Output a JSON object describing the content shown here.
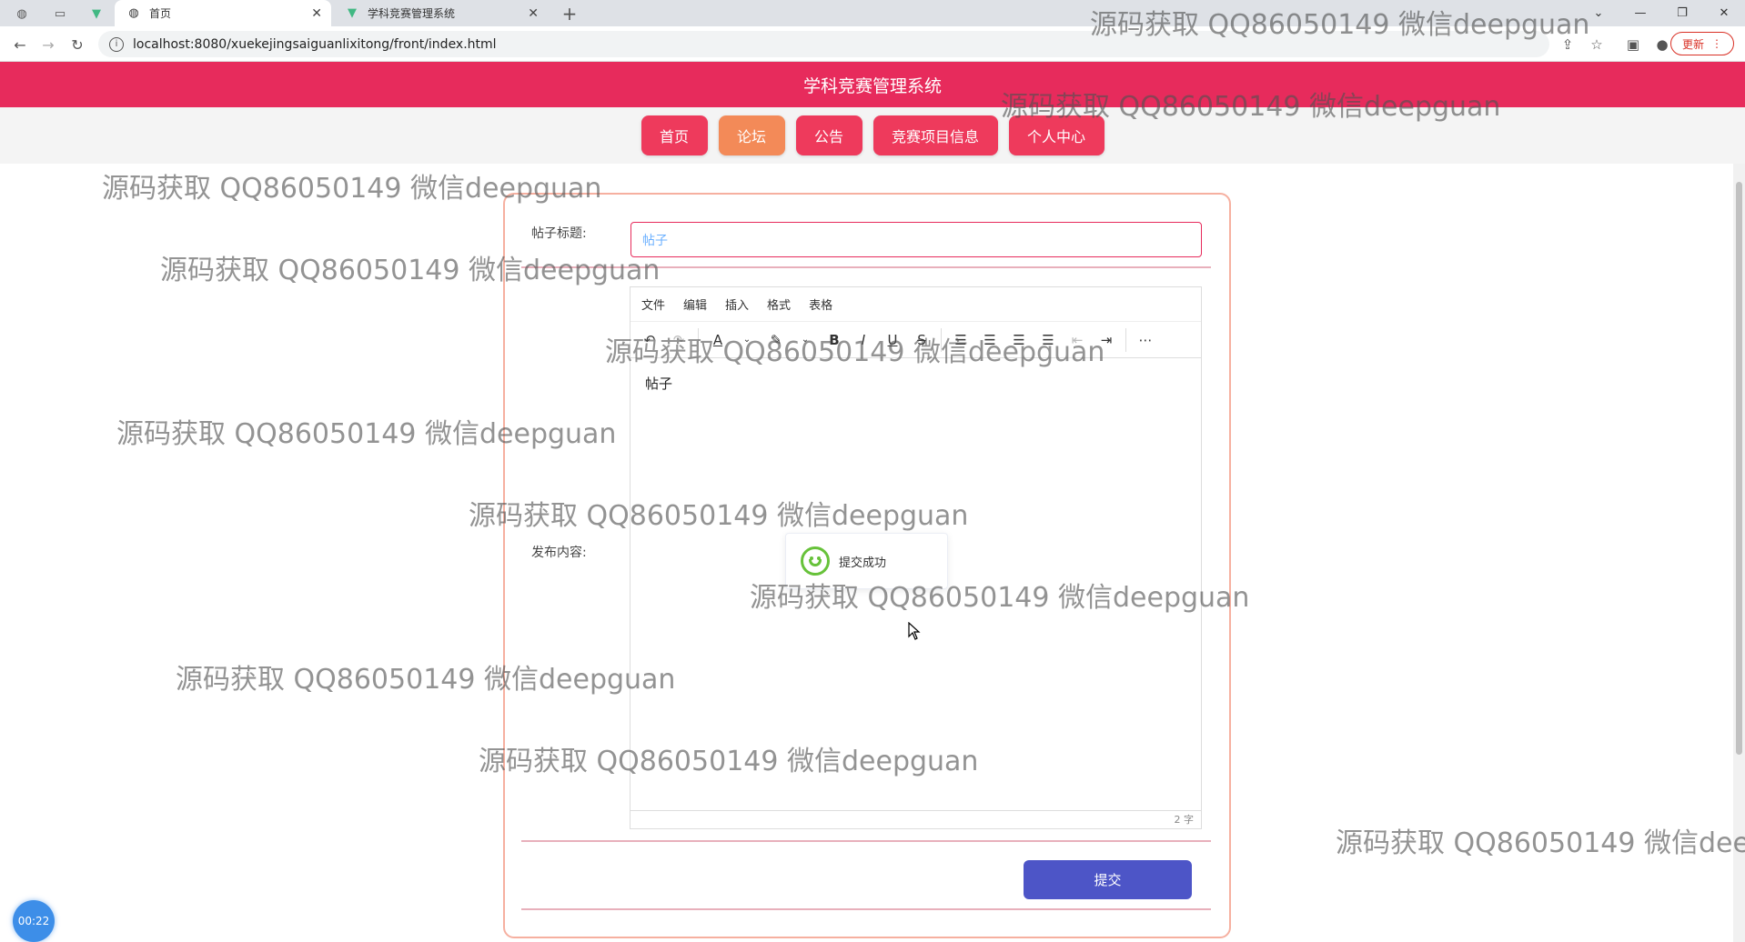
{
  "browser": {
    "tabs": [
      {
        "title": "首页",
        "icon": "globe-icon"
      },
      {
        "title": "学科竞赛管理系统",
        "icon": "vue-logo-icon"
      }
    ],
    "new_tab_symbol": "+",
    "url": "localhost:8080/xuekejingsaiguanlixitong/front/index.html",
    "update_label": "更新"
  },
  "site": {
    "title": "学科竞赛管理系统",
    "nav": [
      {
        "label": "首页",
        "active": false
      },
      {
        "label": "论坛",
        "active": true
      },
      {
        "label": "公告",
        "active": false
      },
      {
        "label": "竞赛项目信息",
        "active": false
      },
      {
        "label": "个人中心",
        "active": false
      }
    ]
  },
  "form": {
    "title_label": "帖子标题:",
    "title_value": "帖子",
    "content_label": "发布内容:",
    "submit_label": "提交"
  },
  "editor": {
    "menu": [
      "文件",
      "编辑",
      "插入",
      "格式",
      "表格"
    ],
    "body_text": "帖子",
    "word_count": "2 字"
  },
  "toast": {
    "message": "提交成功",
    "color": "#67c23a"
  },
  "recording_timer": "00:22",
  "watermark": "源码获取 QQ86050149 微信deepguan",
  "colors": {
    "header": "#e72b5c",
    "nav_button": "#ee3a5c",
    "nav_active": "#f38a58",
    "submit_button": "#4d55c7"
  }
}
